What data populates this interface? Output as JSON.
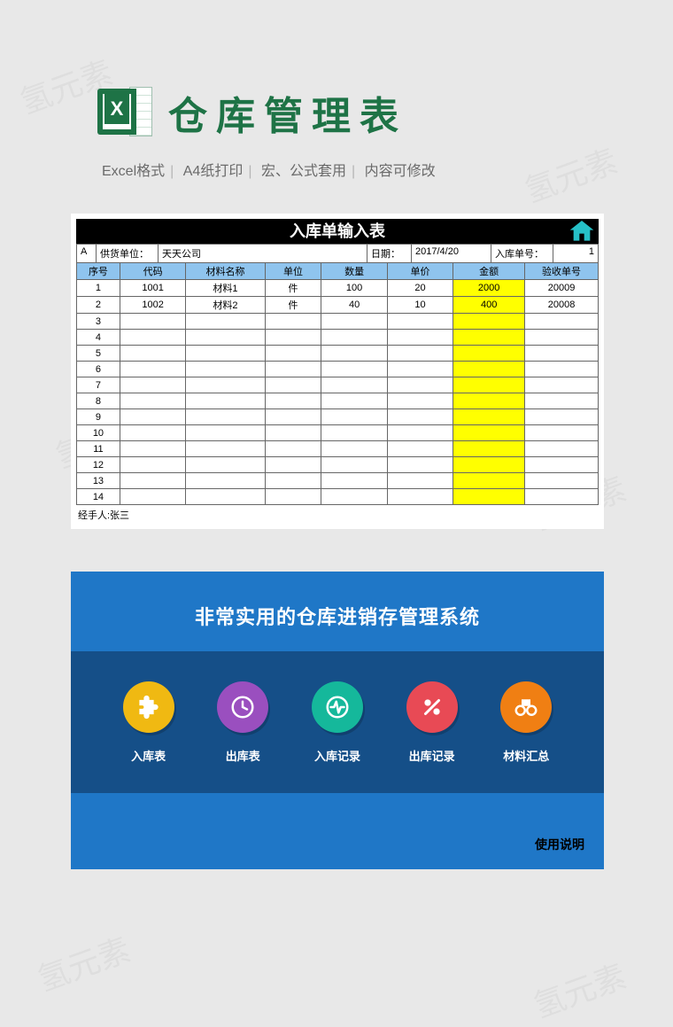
{
  "watermark_text": "氢元素",
  "header": {
    "icon_letter": "X",
    "title": "仓库管理表"
  },
  "subinfo": {
    "a": "Excel格式",
    "b": "A4纸打印",
    "c": "宏、公式套用",
    "d": "内容可修改"
  },
  "sheet": {
    "title": "入库单输入表",
    "meta": {
      "colA": "A",
      "supplier_label": "供货单位：",
      "supplier_value": "天天公司",
      "date_label": "日期：",
      "date_value": "2017/4/20",
      "slip_label": "入库单号：",
      "slip_value": "1"
    },
    "columns": [
      "序号",
      "代码",
      "材料名称",
      "单位",
      "数量",
      "单价",
      "金额",
      "验收单号"
    ],
    "rows": [
      {
        "no": "1",
        "code": "1001",
        "name": "材料1",
        "unit": "件",
        "qty": "100",
        "price": "20",
        "amount": "2000",
        "receipt": "20009"
      },
      {
        "no": "2",
        "code": "1002",
        "name": "材料2",
        "unit": "件",
        "qty": "40",
        "price": "10",
        "amount": "400",
        "receipt": "20008"
      },
      {
        "no": "3",
        "code": "",
        "name": "",
        "unit": "",
        "qty": "",
        "price": "",
        "amount": "",
        "receipt": ""
      },
      {
        "no": "4",
        "code": "",
        "name": "",
        "unit": "",
        "qty": "",
        "price": "",
        "amount": "",
        "receipt": ""
      },
      {
        "no": "5",
        "code": "",
        "name": "",
        "unit": "",
        "qty": "",
        "price": "",
        "amount": "",
        "receipt": ""
      },
      {
        "no": "6",
        "code": "",
        "name": "",
        "unit": "",
        "qty": "",
        "price": "",
        "amount": "",
        "receipt": ""
      },
      {
        "no": "7",
        "code": "",
        "name": "",
        "unit": "",
        "qty": "",
        "price": "",
        "amount": "",
        "receipt": ""
      },
      {
        "no": "8",
        "code": "",
        "name": "",
        "unit": "",
        "qty": "",
        "price": "",
        "amount": "",
        "receipt": ""
      },
      {
        "no": "9",
        "code": "",
        "name": "",
        "unit": "",
        "qty": "",
        "price": "",
        "amount": "",
        "receipt": ""
      },
      {
        "no": "10",
        "code": "",
        "name": "",
        "unit": "",
        "qty": "",
        "price": "",
        "amount": "",
        "receipt": ""
      },
      {
        "no": "11",
        "code": "",
        "name": "",
        "unit": "",
        "qty": "",
        "price": "",
        "amount": "",
        "receipt": ""
      },
      {
        "no": "12",
        "code": "",
        "name": "",
        "unit": "",
        "qty": "",
        "price": "",
        "amount": "",
        "receipt": ""
      },
      {
        "no": "13",
        "code": "",
        "name": "",
        "unit": "",
        "qty": "",
        "price": "",
        "amount": "",
        "receipt": ""
      },
      {
        "no": "14",
        "code": "",
        "name": "",
        "unit": "",
        "qty": "",
        "price": "",
        "amount": "",
        "receipt": ""
      }
    ],
    "footer": "经手人:张三"
  },
  "dashboard": {
    "title": "非常实用的仓库进销存管理系统",
    "items": [
      {
        "label": "入库表",
        "color": "#f0b912",
        "icon": "puzzle"
      },
      {
        "label": "出库表",
        "color": "#9a4fbf",
        "icon": "clock"
      },
      {
        "label": "入库记录",
        "color": "#15b89b",
        "icon": "pulse"
      },
      {
        "label": "出库记录",
        "color": "#e84a55",
        "icon": "percent"
      },
      {
        "label": "材料汇总",
        "color": "#f07f13",
        "icon": "binoculars"
      }
    ],
    "instructions": "使用说明"
  }
}
